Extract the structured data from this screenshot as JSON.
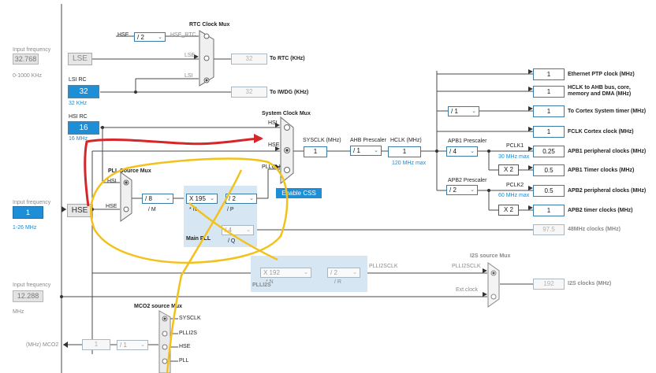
{
  "inputs": {
    "lse_freq_label": "Input frequency",
    "lse_freq_value": "32.768",
    "lse_range": "0-1000 KHz",
    "hse_freq_label": "Input frequency",
    "hse_freq_value": "1",
    "hse_range": "1-26 MHz",
    "i2s_freq_label": "Input frequency",
    "i2s_freq_value": "12.288",
    "i2s_unit": "MHz",
    "mco2_label": "(MHz) MCO2"
  },
  "oscillators": {
    "lse": "LSE",
    "hse": "HSE",
    "lsi_rc_label": "LSI RC",
    "lsi_value": "32",
    "lsi_unit": "32 KHz",
    "hsi_rc_label": "HSI RC",
    "hsi_value": "16",
    "hsi_unit": "16 MHz"
  },
  "rtc": {
    "mux_title": "RTC Clock Mux",
    "hse_label": "HSE",
    "div": "/ 2",
    "hse_rtc": "HSE_RTC",
    "lse": "LSE",
    "lsi": "LSI",
    "rtc_value": "32",
    "rtc_label": "To RTC (KHz)",
    "iwdg_value": "32",
    "iwdg_label": "To IWDG (KHz)"
  },
  "system_mux": {
    "title": "System Clock Mux",
    "hsi": "HSI",
    "hse": "HSE",
    "pllclk": "PLLCLK",
    "sysclk_label": "SYSCLK (MHz)",
    "sysclk_value": "1",
    "ahb_label": "AHB Prescaler",
    "ahb_value": "/ 1",
    "hclk_label": "HCLK (MHz)",
    "hclk_value": "1",
    "hclk_max": "120 MHz max",
    "enable_css": "Enable CSS"
  },
  "pll": {
    "source_mux_title": "PLL Source Mux",
    "hsi": "HSI",
    "hse": "HSE",
    "m_value": "/ 8",
    "m_label": "/ M",
    "n_value": "X 195",
    "n_label": "* N",
    "p_value": "/ 2",
    "p_label": "/ P",
    "q_value": "/ 4",
    "q_label": "/ Q",
    "main_pll": "Main PLL",
    "clk48_value": "97.5",
    "clk48_label": "48MHz clocks (MHz)"
  },
  "plli2s": {
    "title": "PLLI2S",
    "n_value": "X 192",
    "n_label": "* N",
    "r_value": "/ 2",
    "r_label": "/ R",
    "out_label": "PLLI2SCLK",
    "mux_in": "PLLI2SCLK",
    "ext_clock": "Ext.clock",
    "mux_title": "I2S source Mux",
    "i2s_value": "192",
    "i2s_label": "I2S clocks (MHz)"
  },
  "mco2": {
    "mux_title": "MCO2 source Mux",
    "sysclk": "SYSCLK",
    "plli2s": "PLLI2S",
    "hse": "HSE",
    "pll": "PLL",
    "div_value": "/ 1",
    "out_value": "1"
  },
  "outputs": {
    "ethernet": {
      "value": "1",
      "label": "Ethernet PTP clock (MHz)"
    },
    "hclk_ahb": {
      "value": "1",
      "label": "HCLK to AHB bus, core, memory and DMA (MHz)"
    },
    "cortex_div": "/ 1",
    "cortex": {
      "value": "1",
      "label": "To Cortex System timer (MHz)"
    },
    "fclk": {
      "value": "1",
      "label": "FCLK Cortex clock (MHz)"
    },
    "apb1_prescaler_label": "APB1 Prescaler",
    "apb1_prescaler_value": "/ 4",
    "pclk1_label": "PCLK1",
    "pclk1_max": "30 MHz max",
    "apb1_periph": {
      "value": "0.25",
      "label": "APB1 peripheral clocks (MHz)"
    },
    "apb1_timer_mult": "X 2",
    "apb1_timer": {
      "value": "0.5",
      "label": "APB1 Timer clocks (MHz)"
    },
    "apb2_prescaler_label": "APB2 Prescaler",
    "apb2_prescaler_value": "/ 2",
    "pclk2_label": "PCLK2",
    "pclk2_max": "60 MHz max",
    "apb2_periph": {
      "value": "0.5",
      "label": "APB2 peripheral clocks (MHz)"
    },
    "apb2_timer_mult": "X 2",
    "apb2_timer": {
      "value": "1",
      "label": "APB2 timer clocks (MHz)"
    }
  },
  "colors": {
    "accent": "#1e8fd6",
    "border": "#3a7ca8",
    "annotation_red": "#d6262a",
    "annotation_yellow": "#f2c21b"
  }
}
